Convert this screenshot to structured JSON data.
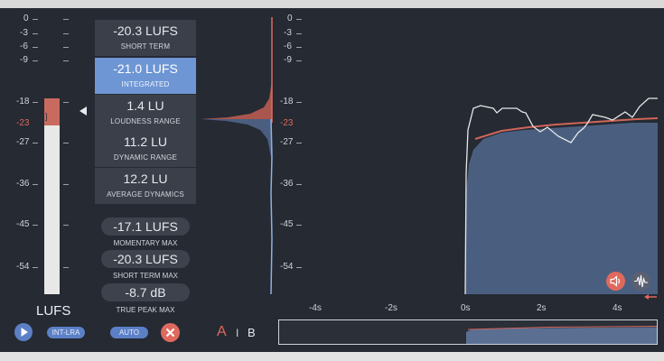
{
  "meter": {
    "scale": [
      "0",
      "-3",
      "-6",
      "-9",
      "-18",
      "-23",
      "-27",
      "-36",
      "-45",
      "-54"
    ],
    "highlight_tick": "-23",
    "unit_label": "LUFS",
    "level_db": -23,
    "bracket_label": "[ ]",
    "arrow_icon": "left-triangle"
  },
  "stats": [
    {
      "value": "-20.3 LUFS",
      "name": "SHORT TERM",
      "selected": false
    },
    {
      "value": "-21.0 LUFS",
      "name": "INTEGRATED",
      "selected": true
    },
    {
      "value": "1.4 LU",
      "name": "LOUDNESS RANGE",
      "selected": false
    },
    {
      "value": "11.2 LU",
      "name": "DYNAMIC RANGE",
      "selected": false
    },
    {
      "value": "12.2 LU",
      "name": "AVERAGE DYNAMICS",
      "selected": false
    }
  ],
  "max_pills": [
    {
      "value": "-17.1 LUFS",
      "name": "MOMENTARY MAX"
    },
    {
      "value": "-20.3 LUFS",
      "name": "SHORT TERM MAX"
    },
    {
      "value": "-8.7 dB",
      "name": "TRUE PEAK MAX"
    }
  ],
  "controls": {
    "play_icon": "play-icon",
    "int_lra_label": "INT-LRA",
    "auto_label": "AUTO",
    "reset_icon": "close-icon",
    "ab": {
      "a": "A",
      "sep": "I",
      "b": "B",
      "active": "A"
    }
  },
  "history": {
    "scale": [
      "0",
      "-3",
      "-6",
      "-9",
      "-18",
      "-23",
      "-27",
      "-36",
      "-45",
      "-54"
    ],
    "time_labels": [
      "-4s",
      "-2s",
      "0s",
      "2s",
      "4s"
    ],
    "speaker_icon": "speaker-icon",
    "waveform_icon": "waveform-icon"
  },
  "colors": {
    "background": "#252a33",
    "accent_blue": "#6e96d4",
    "accent_red": "#e06a5a",
    "fill_blue": "#4a5f80"
  }
}
